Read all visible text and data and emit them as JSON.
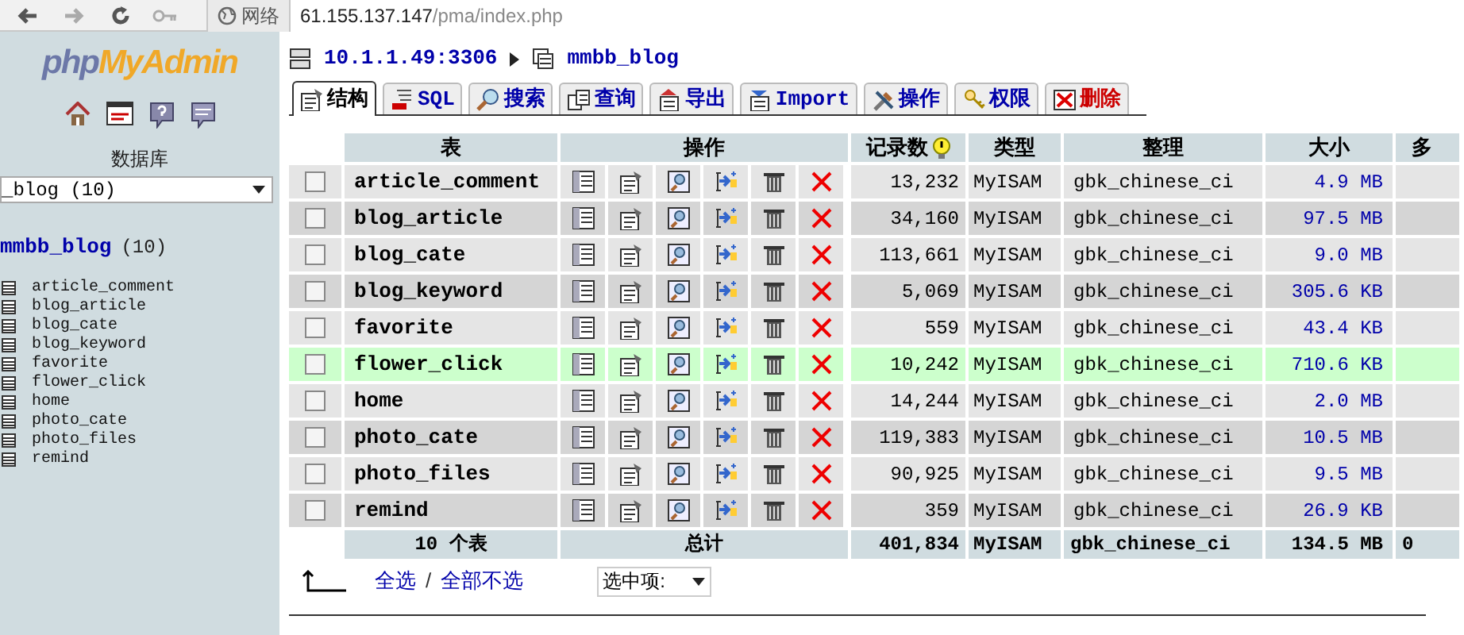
{
  "browser": {
    "zone": "网络",
    "address_host": "61.155.137.147",
    "address_path": "/pma/index.php"
  },
  "sidebar": {
    "logo_left": "php",
    "logo_right": "MyAdmin",
    "database_label": "数据库",
    "database_select": "_blog (10)",
    "db_title": "mmbb_blog",
    "db_count": "(10)",
    "tables": [
      "article_comment",
      "blog_article",
      "blog_cate",
      "blog_keyword",
      "favorite",
      "flower_click",
      "home",
      "photo_cate",
      "photo_files",
      "remind"
    ]
  },
  "breadcrumb": {
    "server": "10.1.1.49:3306",
    "database": "mmbb_blog"
  },
  "tabs": [
    {
      "label": "结构",
      "selected": true
    },
    {
      "label": "SQL",
      "selected": false
    },
    {
      "label": "搜索",
      "selected": false
    },
    {
      "label": "查询",
      "selected": false
    },
    {
      "label": "导出",
      "selected": false
    },
    {
      "label": "Import",
      "selected": false
    },
    {
      "label": "操作",
      "selected": false
    },
    {
      "label": "权限",
      "selected": false
    },
    {
      "label": "删除",
      "selected": false
    }
  ],
  "table": {
    "columns": [
      "表",
      "操作",
      "记录数",
      "类型",
      "整理",
      "大小",
      "多"
    ],
    "rows": [
      {
        "name": "article_comment",
        "records": "13,232",
        "type": "MyISAM",
        "collation": "gbk_chinese_ci",
        "size": "4.9 MB",
        "checked": false,
        "selected": false
      },
      {
        "name": "blog_article",
        "records": "34,160",
        "type": "MyISAM",
        "collation": "gbk_chinese_ci",
        "size": "97.5 MB",
        "checked": false,
        "selected": false
      },
      {
        "name": "blog_cate",
        "records": "113,661",
        "type": "MyISAM",
        "collation": "gbk_chinese_ci",
        "size": "9.0 MB",
        "checked": false,
        "selected": false
      },
      {
        "name": "blog_keyword",
        "records": "5,069",
        "type": "MyISAM",
        "collation": "gbk_chinese_ci",
        "size": "305.6 KB",
        "checked": false,
        "selected": false
      },
      {
        "name": "favorite",
        "records": "559",
        "type": "MyISAM",
        "collation": "gbk_chinese_ci",
        "size": "43.4 KB",
        "checked": false,
        "selected": false
      },
      {
        "name": "flower_click",
        "records": "10,242",
        "type": "MyISAM",
        "collation": "gbk_chinese_ci",
        "size": "710.6 KB",
        "checked": false,
        "selected": true
      },
      {
        "name": "home",
        "records": "14,244",
        "type": "MyISAM",
        "collation": "gbk_chinese_ci",
        "size": "2.0 MB",
        "checked": false,
        "selected": false
      },
      {
        "name": "photo_cate",
        "records": "119,383",
        "type": "MyISAM",
        "collation": "gbk_chinese_ci",
        "size": "10.5 MB",
        "checked": false,
        "selected": false
      },
      {
        "name": "photo_files",
        "records": "90,925",
        "type": "MyISAM",
        "collation": "gbk_chinese_ci",
        "size": "9.5 MB",
        "checked": false,
        "selected": false
      },
      {
        "name": "remind",
        "records": "359",
        "type": "MyISAM",
        "collation": "gbk_chinese_ci",
        "size": "26.9 KB",
        "checked": false,
        "selected": false
      }
    ],
    "footer": {
      "count": "10 个表",
      "label": "总计",
      "records": "401,834",
      "type": "MyISAM",
      "collation": "gbk_chinese_ci",
      "size": "134.5 MB",
      "overhead": "0"
    }
  },
  "actions": {
    "select_all": "全选",
    "separator": "/",
    "deselect_all": "全部不选",
    "with_selected": "选中项:"
  }
}
